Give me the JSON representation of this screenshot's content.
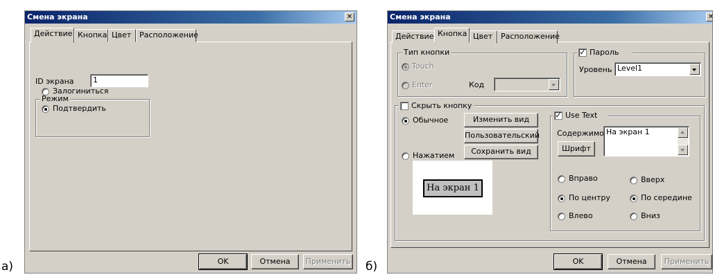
{
  "captions": {
    "a": "а)",
    "b": "б)"
  },
  "dialog_a": {
    "title": "Смена экрана",
    "close_glyph": "✕",
    "tabs": [
      "Действие",
      "Кнопка",
      "Цвет",
      "Расположение"
    ],
    "active_tab": "Действие",
    "screen_id_label": "ID экрана",
    "screen_id_value": "1",
    "mode_group": "Режим",
    "mode_options": [
      "Залогиниться",
      "Подтвердить"
    ],
    "mode_selected": "Подтвердить",
    "buttons": {
      "ok": "OK",
      "cancel": "Отмена",
      "apply": "Применить"
    }
  },
  "dialog_b": {
    "title": "Смена экрана",
    "close_glyph": "✕",
    "tabs": [
      "Действие",
      "Кнопка",
      "Цвет",
      "Расположение"
    ],
    "active_tab": "Кнопка",
    "button_type": {
      "group": "Тип кнопки",
      "options": [
        "Touch",
        "Enter"
      ],
      "selected": "Touch",
      "code_label": "Код",
      "code_value": ""
    },
    "password": {
      "label": "Пароль",
      "checked": true,
      "level_label": "Уровень",
      "level_value": "Level1"
    },
    "hide_button": {
      "label": "Скрыть кнопку",
      "checked": false,
      "state_options": [
        "Обычное",
        "Нажатием"
      ],
      "state_selected": "Обычное",
      "change_view_button": "Изменить вид",
      "custom_button": "Пользовательский",
      "save_view_button": "Сохранить вид",
      "preview_text": "На экран 1"
    },
    "use_text": {
      "label": "Use Text",
      "checked": true,
      "content_label": "Содержимое",
      "content_value": "На экран 1",
      "font_button": "Шрифт",
      "h_align": [
        "Вправо",
        "По центру",
        "Влево"
      ],
      "h_selected": "По центру",
      "v_align": [
        "Вверх",
        "По середине",
        "Вниз"
      ],
      "v_selected": "По середине"
    },
    "buttons": {
      "ok": "OK",
      "cancel": "Отмена",
      "apply": "Применить"
    }
  }
}
